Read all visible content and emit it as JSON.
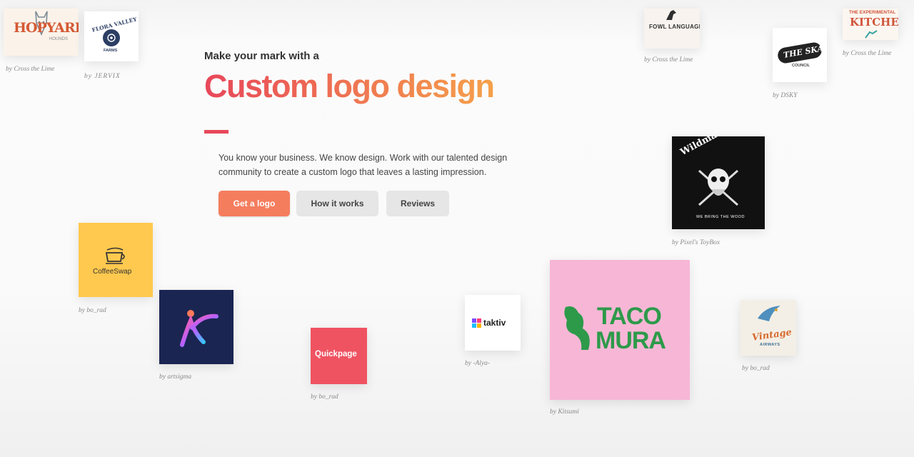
{
  "hero": {
    "eyebrow": "Make your mark with a",
    "headline": "Custom logo design",
    "description": "You know your business. We know design. Work with our talented design community to create a custom logo that leaves a lasting impression.",
    "buttons": {
      "get_logo": "Get a logo",
      "how_it_works": "How it works",
      "reviews": "Reviews"
    }
  },
  "colors": {
    "headline_start": "#e8475a",
    "headline_end": "#f5a14a",
    "primary_button": "#f47d5e",
    "secondary_button": "#e6e6e6"
  },
  "logos": [
    {
      "name": "HOPYARD",
      "subtext": "HOUNDS",
      "credit": "by Cross the Lime"
    },
    {
      "name": "FLORA VALLEY",
      "subtext": "FARMS",
      "credit": "by JERVIX"
    },
    {
      "name": "FOWL LANGUAGE",
      "credit": "by Cross the Lime"
    },
    {
      "name": "THE SKATE",
      "subtext": "COUNCIL",
      "credit": "by DSKY"
    },
    {
      "name_line1": "THE EXPERIMENTAL",
      "name_line2": "KITCHEN",
      "credit": "by Cross the Lime"
    },
    {
      "name": "Wildman Firewood",
      "subtext": "WE BRING THE WOOD",
      "credit": "by Pixel's ToyBox"
    },
    {
      "name": "CoffeeSwap",
      "credit": "by bo_rad"
    },
    {
      "name": "",
      "credit": "by artsigma"
    },
    {
      "name": "Quickpage",
      "credit": "by bo_rad"
    },
    {
      "name": "taktiv",
      "credit": "by -Alya-"
    },
    {
      "name_line1": "TACO",
      "name_line2": "MURA",
      "credit": "by Kitsumi"
    },
    {
      "name": "Vintage",
      "subtext": "AIRWAYS",
      "credit": "by bo_rad"
    }
  ]
}
